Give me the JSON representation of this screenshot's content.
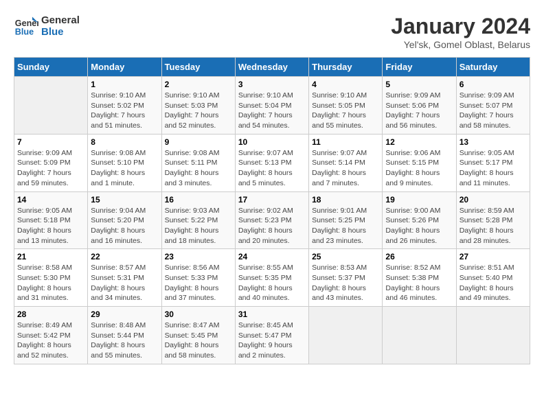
{
  "header": {
    "logo_line1": "General",
    "logo_line2": "Blue",
    "title": "January 2024",
    "subtitle": "Yel'sk, Gomel Oblast, Belarus"
  },
  "weekdays": [
    "Sunday",
    "Monday",
    "Tuesday",
    "Wednesday",
    "Thursday",
    "Friday",
    "Saturday"
  ],
  "weeks": [
    [
      {
        "day": "",
        "info": ""
      },
      {
        "day": "1",
        "info": "Sunrise: 9:10 AM\nSunset: 5:02 PM\nDaylight: 7 hours\nand 51 minutes."
      },
      {
        "day": "2",
        "info": "Sunrise: 9:10 AM\nSunset: 5:03 PM\nDaylight: 7 hours\nand 52 minutes."
      },
      {
        "day": "3",
        "info": "Sunrise: 9:10 AM\nSunset: 5:04 PM\nDaylight: 7 hours\nand 54 minutes."
      },
      {
        "day": "4",
        "info": "Sunrise: 9:10 AM\nSunset: 5:05 PM\nDaylight: 7 hours\nand 55 minutes."
      },
      {
        "day": "5",
        "info": "Sunrise: 9:09 AM\nSunset: 5:06 PM\nDaylight: 7 hours\nand 56 minutes."
      },
      {
        "day": "6",
        "info": "Sunrise: 9:09 AM\nSunset: 5:07 PM\nDaylight: 7 hours\nand 58 minutes."
      }
    ],
    [
      {
        "day": "7",
        "info": "Sunrise: 9:09 AM\nSunset: 5:09 PM\nDaylight: 7 hours\nand 59 minutes."
      },
      {
        "day": "8",
        "info": "Sunrise: 9:08 AM\nSunset: 5:10 PM\nDaylight: 8 hours\nand 1 minute."
      },
      {
        "day": "9",
        "info": "Sunrise: 9:08 AM\nSunset: 5:11 PM\nDaylight: 8 hours\nand 3 minutes."
      },
      {
        "day": "10",
        "info": "Sunrise: 9:07 AM\nSunset: 5:13 PM\nDaylight: 8 hours\nand 5 minutes."
      },
      {
        "day": "11",
        "info": "Sunrise: 9:07 AM\nSunset: 5:14 PM\nDaylight: 8 hours\nand 7 minutes."
      },
      {
        "day": "12",
        "info": "Sunrise: 9:06 AM\nSunset: 5:15 PM\nDaylight: 8 hours\nand 9 minutes."
      },
      {
        "day": "13",
        "info": "Sunrise: 9:05 AM\nSunset: 5:17 PM\nDaylight: 8 hours\nand 11 minutes."
      }
    ],
    [
      {
        "day": "14",
        "info": "Sunrise: 9:05 AM\nSunset: 5:18 PM\nDaylight: 8 hours\nand 13 minutes."
      },
      {
        "day": "15",
        "info": "Sunrise: 9:04 AM\nSunset: 5:20 PM\nDaylight: 8 hours\nand 16 minutes."
      },
      {
        "day": "16",
        "info": "Sunrise: 9:03 AM\nSunset: 5:22 PM\nDaylight: 8 hours\nand 18 minutes."
      },
      {
        "day": "17",
        "info": "Sunrise: 9:02 AM\nSunset: 5:23 PM\nDaylight: 8 hours\nand 20 minutes."
      },
      {
        "day": "18",
        "info": "Sunrise: 9:01 AM\nSunset: 5:25 PM\nDaylight: 8 hours\nand 23 minutes."
      },
      {
        "day": "19",
        "info": "Sunrise: 9:00 AM\nSunset: 5:26 PM\nDaylight: 8 hours\nand 26 minutes."
      },
      {
        "day": "20",
        "info": "Sunrise: 8:59 AM\nSunset: 5:28 PM\nDaylight: 8 hours\nand 28 minutes."
      }
    ],
    [
      {
        "day": "21",
        "info": "Sunrise: 8:58 AM\nSunset: 5:30 PM\nDaylight: 8 hours\nand 31 minutes."
      },
      {
        "day": "22",
        "info": "Sunrise: 8:57 AM\nSunset: 5:31 PM\nDaylight: 8 hours\nand 34 minutes."
      },
      {
        "day": "23",
        "info": "Sunrise: 8:56 AM\nSunset: 5:33 PM\nDaylight: 8 hours\nand 37 minutes."
      },
      {
        "day": "24",
        "info": "Sunrise: 8:55 AM\nSunset: 5:35 PM\nDaylight: 8 hours\nand 40 minutes."
      },
      {
        "day": "25",
        "info": "Sunrise: 8:53 AM\nSunset: 5:37 PM\nDaylight: 8 hours\nand 43 minutes."
      },
      {
        "day": "26",
        "info": "Sunrise: 8:52 AM\nSunset: 5:38 PM\nDaylight: 8 hours\nand 46 minutes."
      },
      {
        "day": "27",
        "info": "Sunrise: 8:51 AM\nSunset: 5:40 PM\nDaylight: 8 hours\nand 49 minutes."
      }
    ],
    [
      {
        "day": "28",
        "info": "Sunrise: 8:49 AM\nSunset: 5:42 PM\nDaylight: 8 hours\nand 52 minutes."
      },
      {
        "day": "29",
        "info": "Sunrise: 8:48 AM\nSunset: 5:44 PM\nDaylight: 8 hours\nand 55 minutes."
      },
      {
        "day": "30",
        "info": "Sunrise: 8:47 AM\nSunset: 5:45 PM\nDaylight: 8 hours\nand 58 minutes."
      },
      {
        "day": "31",
        "info": "Sunrise: 8:45 AM\nSunset: 5:47 PM\nDaylight: 9 hours\nand 2 minutes."
      },
      {
        "day": "",
        "info": ""
      },
      {
        "day": "",
        "info": ""
      },
      {
        "day": "",
        "info": ""
      }
    ]
  ]
}
